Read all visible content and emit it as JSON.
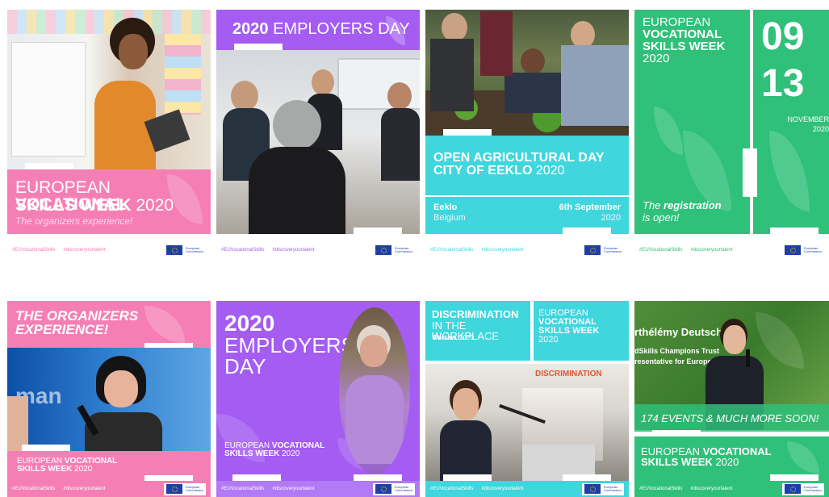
{
  "hashtags": {
    "vet": "#EUVocationalSkills",
    "talent": "#discoveryourtalent"
  },
  "commission": "European Commission",
  "colors": {
    "pink": "#f57fb5",
    "violet": "#a45cf2",
    "teal": "#3fd6dd",
    "green": "#2fc07a",
    "lime": "#28b46b"
  },
  "cards": [
    {
      "id": "c1",
      "line1_a": "EUROPEAN ",
      "line1_b": "VOCATIONAL",
      "line2_a": "SKILLS WEEK ",
      "line2_b": "2020",
      "subtitle": "The organizers experience!"
    },
    {
      "id": "c2",
      "title_a": "2020 ",
      "title_b": "EMPLOYERS DAY"
    },
    {
      "id": "c3",
      "title1": "OPEN AGRICULTURAL DAY",
      "title2_a": "CITY OF EEKLO ",
      "title2_b": "2020",
      "city": "Eeklo",
      "country": "Belgium",
      "date": "6th September",
      "year": "2020"
    },
    {
      "id": "c4",
      "l1": "EUROPEAN",
      "l2": "VOCATIONAL",
      "l3": "SKILLS WEEK",
      "l4": "2020",
      "d1": "09",
      "d2": "13",
      "month": "NOVEMBER",
      "year": "2020",
      "reg_a": "The ",
      "reg_b": "registration",
      "reg_c": "is open!"
    },
    {
      "id": "c5",
      "t1": "THE ORGANIZERS",
      "t2": "EXPERIENCE!",
      "bg_word": "man",
      "l1_a": "EUROPEAN ",
      "l1_b": "VOCATIONAL",
      "l2_a": "SKILLS WEEK ",
      "l2_b": "2020"
    },
    {
      "id": "c6",
      "t1": "2020",
      "t2": "EMPLOYERS",
      "t3": "DAY",
      "l1_a": "EUROPEAN ",
      "l1_b": "VOCATIONAL",
      "l2_a": "SKILLS WEEK ",
      "l2_b": "2020"
    },
    {
      "id": "c7",
      "t1": "DISCRIMINATION",
      "t2": "IN THE WORKPLACE",
      "place": "Warsaw",
      "year": ", 2020",
      "r1": "EUROPEAN",
      "r2": "VOCATIONAL",
      "r3": "SKILLS WEEK",
      "r4": "2020",
      "banner": "DISCRIMINATION"
    },
    {
      "id": "c8",
      "name": "rthélémy Deutsch",
      "role1": "dSkills Champions Trust",
      "role2": "resentative for Europe",
      "headline": "174 EVENTS & MUCH MORE SOON!",
      "l1_a": "EUROPEAN ",
      "l1_b": "VOCATIONAL",
      "l2_a": "SKILLS WEEK ",
      "l2_b": "2020"
    }
  ]
}
